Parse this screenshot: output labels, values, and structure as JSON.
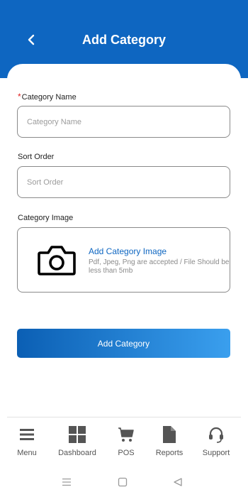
{
  "header": {
    "title": "Add Category",
    "back_icon": "chevron-left-icon"
  },
  "form": {
    "category_name": {
      "label": "Category Name",
      "placeholder": "Category Name",
      "value": "",
      "required_mark": "*"
    },
    "sort_order": {
      "label": "Sort Order",
      "placeholder": "Sort Order",
      "value": ""
    },
    "category_image": {
      "label": "Category Image",
      "upload_title": "Add Category Image",
      "upload_hint": "Pdf, Jpeg, Png are accepted / File Should be less than 5mb",
      "icon": "camera-icon"
    },
    "submit_label": "Add Category"
  },
  "bottom_nav": {
    "items": [
      {
        "label": "Menu",
        "icon": "hamburger-menu-icon"
      },
      {
        "label": "Dashboard",
        "icon": "dashboard-grid-icon"
      },
      {
        "label": "POS",
        "icon": "cart-icon"
      },
      {
        "label": "Reports",
        "icon": "document-icon"
      },
      {
        "label": "Support",
        "icon": "headset-icon"
      }
    ]
  },
  "system_nav": {
    "icons": [
      "recents-icon",
      "home-icon",
      "back-triangle-icon"
    ]
  },
  "colors": {
    "primary": "#0e66c1",
    "gradient_end": "#3a9fee",
    "required": "#e02020"
  }
}
